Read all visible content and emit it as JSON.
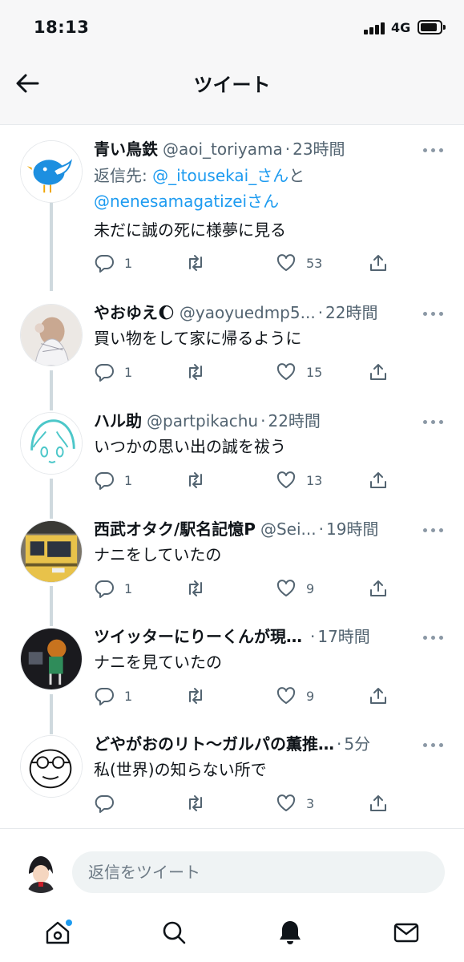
{
  "status_bar": {
    "time": "18:13",
    "network": "4G",
    "battery_level": 0.85
  },
  "header": {
    "title": "ツイート"
  },
  "tweets": [
    {
      "name": "青い鳥鉄",
      "handle": "@aoi_toriyama",
      "time": "23時間",
      "reply_prefix": "返信先: ",
      "reply_user1": "@_itousekai_さん",
      "reply_and": "と",
      "reply_user2": "@nenesamagatizeiさん",
      "text": "未だに誠の死に様夢に見る",
      "replies": "1",
      "retweets": "",
      "likes": "53",
      "avatar_icon": "blue-bird-avatar"
    },
    {
      "name": "やおゆえ🌔",
      "handle": "@yaoyuedmp5...",
      "time": "22時間",
      "text": "買い物をして家に帰るように",
      "replies": "1",
      "retweets": "",
      "likes": "15",
      "avatar_icon": "anime-figure-avatar"
    },
    {
      "name": "ハル助",
      "handle": "@partpikachu",
      "time": "22時間",
      "text": "いつかの思い出の誠を祓う",
      "replies": "1",
      "retweets": "",
      "likes": "13",
      "avatar_icon": "anime-girl-sketch-avatar"
    },
    {
      "name": "西武オタク/駅名記憶P",
      "handle": "@Sei...",
      "time": "19時間",
      "text": "ナニをしていたの",
      "replies": "1",
      "retweets": "",
      "likes": "9",
      "avatar_icon": "train-avatar"
    },
    {
      "name": "ツイッターにりーくんが現…",
      "handle": "",
      "time": "17時間",
      "text": "ナニを見ていたの",
      "replies": "1",
      "retweets": "",
      "likes": "9",
      "avatar_icon": "game-character-avatar"
    },
    {
      "name": "どやがおのリト～ガルパの薫推…",
      "handle": "",
      "time": "5分",
      "text": "私(世界)の知らない所で",
      "replies": "",
      "retweets": "",
      "likes": "3",
      "avatar_icon": "glasses-face-avatar"
    }
  ],
  "compose": {
    "placeholder": "返信をツイート"
  },
  "colors": {
    "accent": "#1d9bf0",
    "secondary_text": "#536471",
    "thread_line": "#cfd9de"
  }
}
